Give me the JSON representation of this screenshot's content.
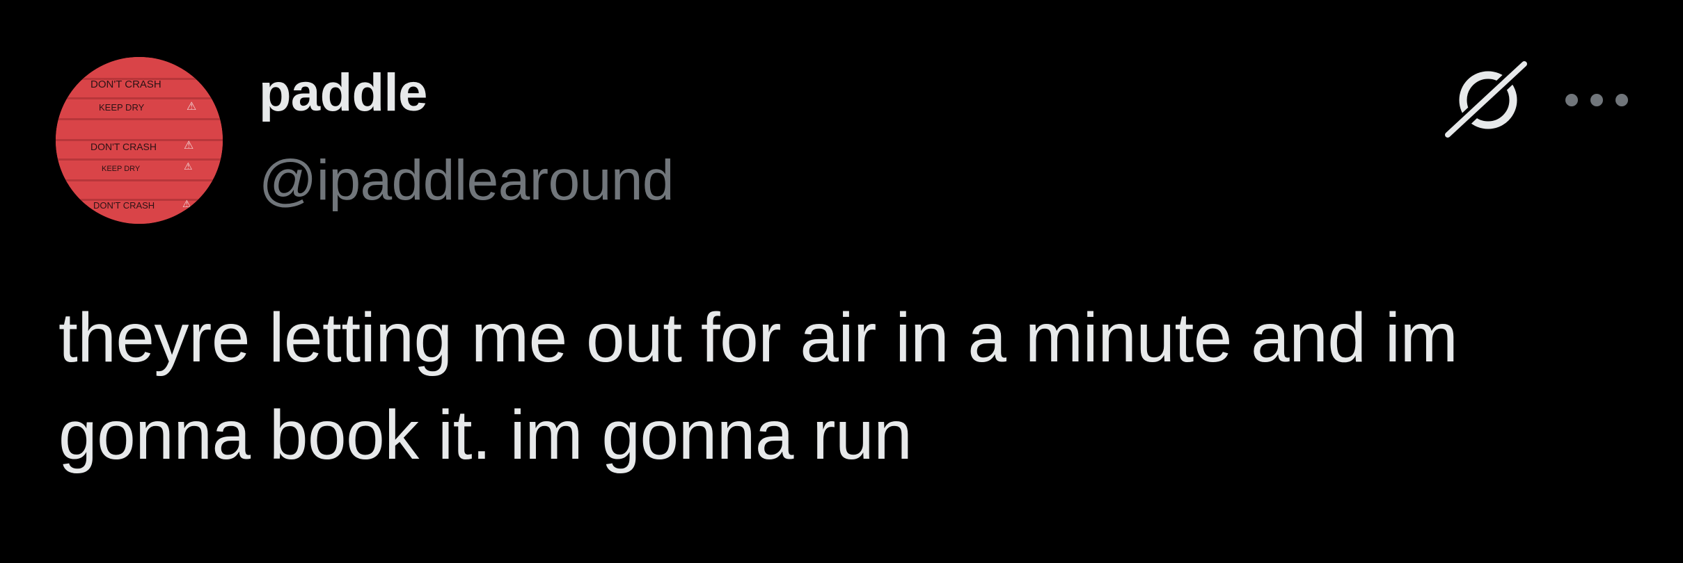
{
  "tweet": {
    "author": {
      "display_name": "paddle",
      "handle": "@ipaddlearound",
      "avatar_text": [
        "DON'T CRASH",
        "KEEP DRY",
        "DON'T CRASH",
        "KEEP DRY",
        "DON'T CRASH"
      ]
    },
    "text": "theyre letting me out for air in a minute and im\ngonna book it. im gonna run",
    "actions": {
      "grok_icon": "grok-icon",
      "more_icon": "more-horizontal-icon"
    }
  },
  "colors": {
    "background": "#000000",
    "primary_text": "#e7e9ea",
    "secondary_text": "#71767b",
    "avatar_red": "#d94448"
  }
}
